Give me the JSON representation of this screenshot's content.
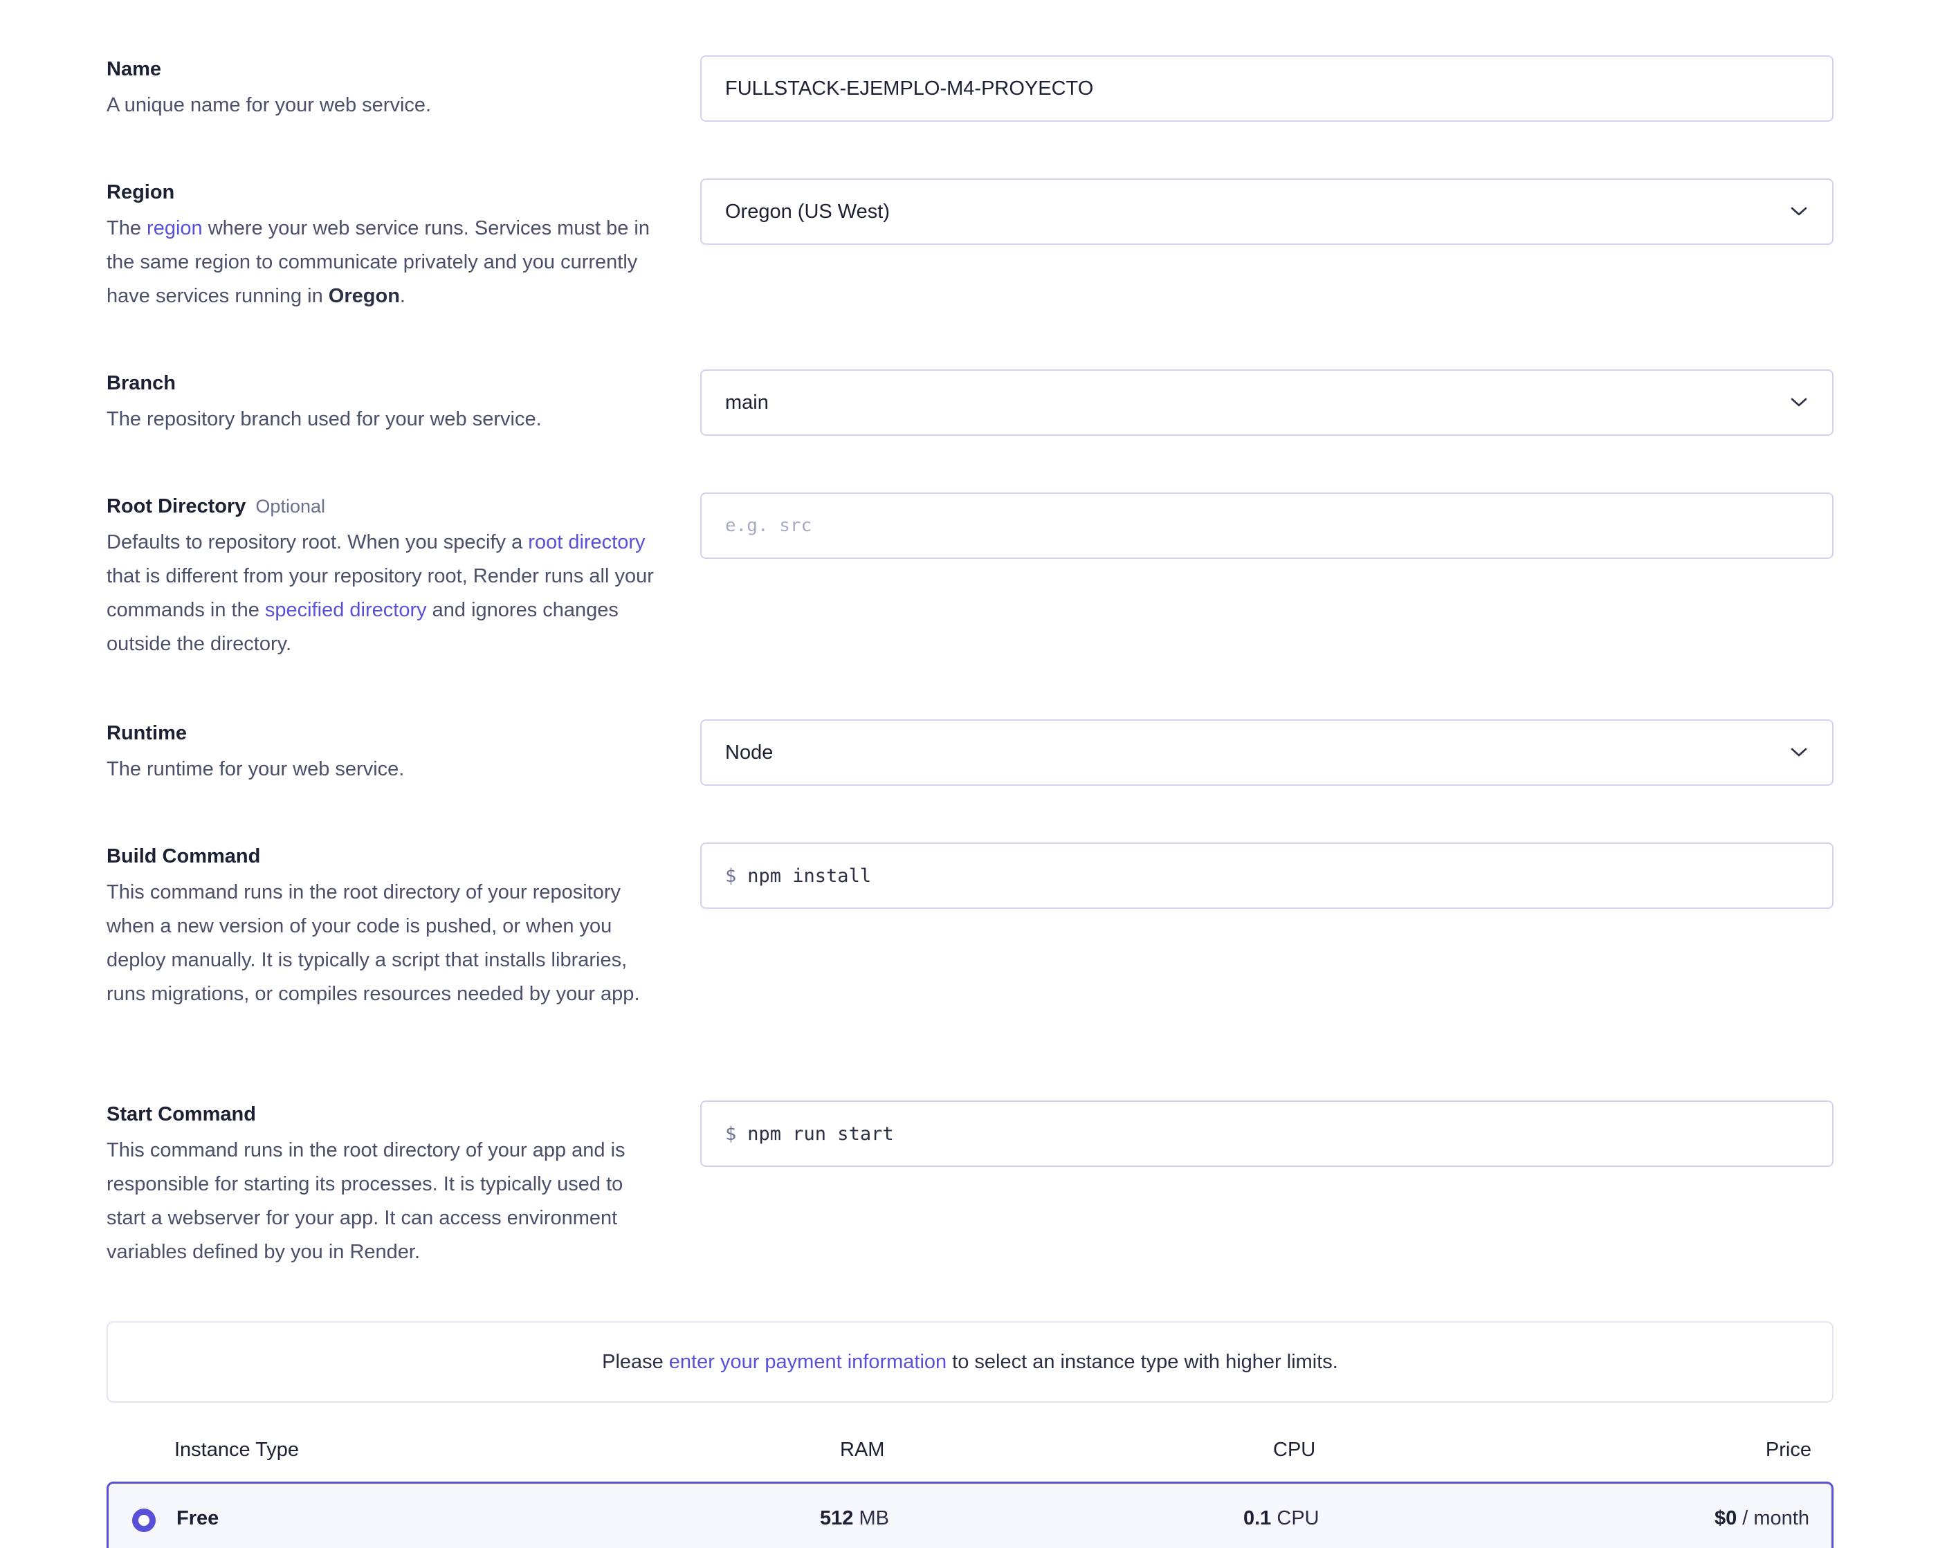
{
  "fields": {
    "name": {
      "label": "Name",
      "help": "A unique name for your web service.",
      "value": "FULLSTACK-EJEMPLO-M4-PROYECTO"
    },
    "region": {
      "label": "Region",
      "help_pre": "The ",
      "help_link": "region",
      "help_post": " where your web service runs. Services must be in the same region to communicate privately and you currently have services running in ",
      "help_bold": "Oregon",
      "help_end": ".",
      "value": "Oregon (US West)"
    },
    "branch": {
      "label": "Branch",
      "help": "The repository branch used for your web service.",
      "value": "main"
    },
    "root_directory": {
      "label": "Root Directory",
      "optional": "Optional",
      "help_pre": "Defaults to repository root. When you specify a ",
      "help_link1": "root directory",
      "help_mid": " that is different from your repository root, Render runs all your commands in the ",
      "help_link2": "specified directory",
      "help_post": " and ignores changes outside the directory.",
      "placeholder": "e.g. src"
    },
    "runtime": {
      "label": "Runtime",
      "help": "The runtime for your web service.",
      "value": "Node"
    },
    "build_command": {
      "label": "Build Command",
      "help": "This command runs in the root directory of your repository when a new version of your code is pushed, or when you deploy manually. It is typically a script that installs libraries, runs migrations, or compiles resources needed by your app.",
      "prompt": "$",
      "value": "npm install"
    },
    "start_command": {
      "label": "Start Command",
      "help": "This command runs in the root directory of your app and is responsible for starting its processes. It is typically used to start a webserver for your app. It can access environment variables defined by you in Render.",
      "prompt": "$",
      "value": "npm run start"
    }
  },
  "notice": {
    "pre": "Please",
    "link": "enter your payment information",
    "post": "to select an instance type with higher limits."
  },
  "instance_table": {
    "headers": {
      "type": "Instance Type",
      "ram": "RAM",
      "cpu": "CPU",
      "price": "Price"
    },
    "rows": [
      {
        "name": "Free",
        "ram_value": "512",
        "ram_unit": "MB",
        "cpu_value": "0.1",
        "cpu_unit": "CPU",
        "price_value": "$0",
        "price_unit": "/ month",
        "selected": true
      }
    ]
  },
  "colors": {
    "accent": "#5850d8",
    "border": "#cfd3ee",
    "text": "#2a2f45"
  }
}
